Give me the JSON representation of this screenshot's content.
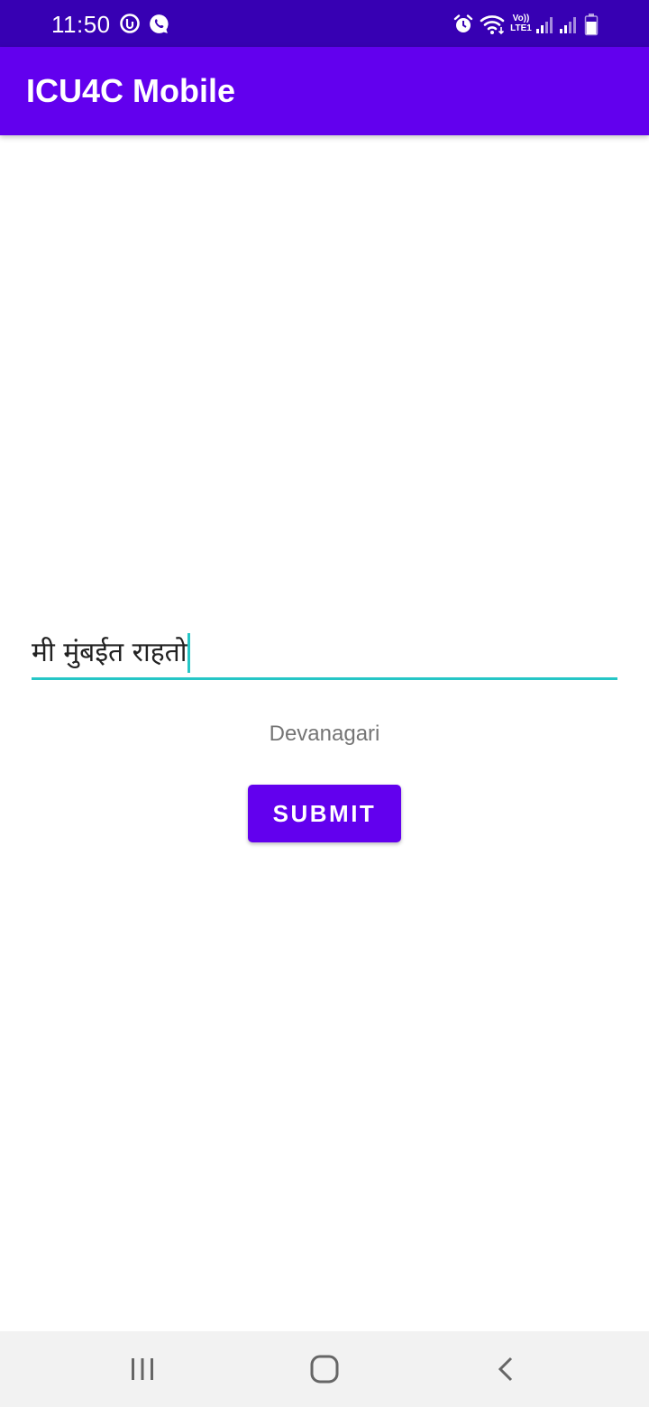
{
  "status_bar": {
    "time": "11:50",
    "icons": [
      "data-saver-icon",
      "viber-icon",
      "alarm-icon",
      "wifi-icon",
      "volte-icon",
      "signal-icon",
      "signal-icon",
      "battery-icon"
    ],
    "volte_text_top": "Vo))",
    "volte_text_bottom": "LTE1"
  },
  "app_bar": {
    "title": "ICU4C Mobile",
    "color": "#6200ee"
  },
  "form": {
    "input_value": "मी मुंबईत राहतो",
    "script_label": "Devanagari",
    "submit_label": "SUBMIT",
    "accent_color": "#26c6c6"
  },
  "nav_bar": {
    "buttons": [
      "recent-apps",
      "home",
      "back"
    ]
  }
}
